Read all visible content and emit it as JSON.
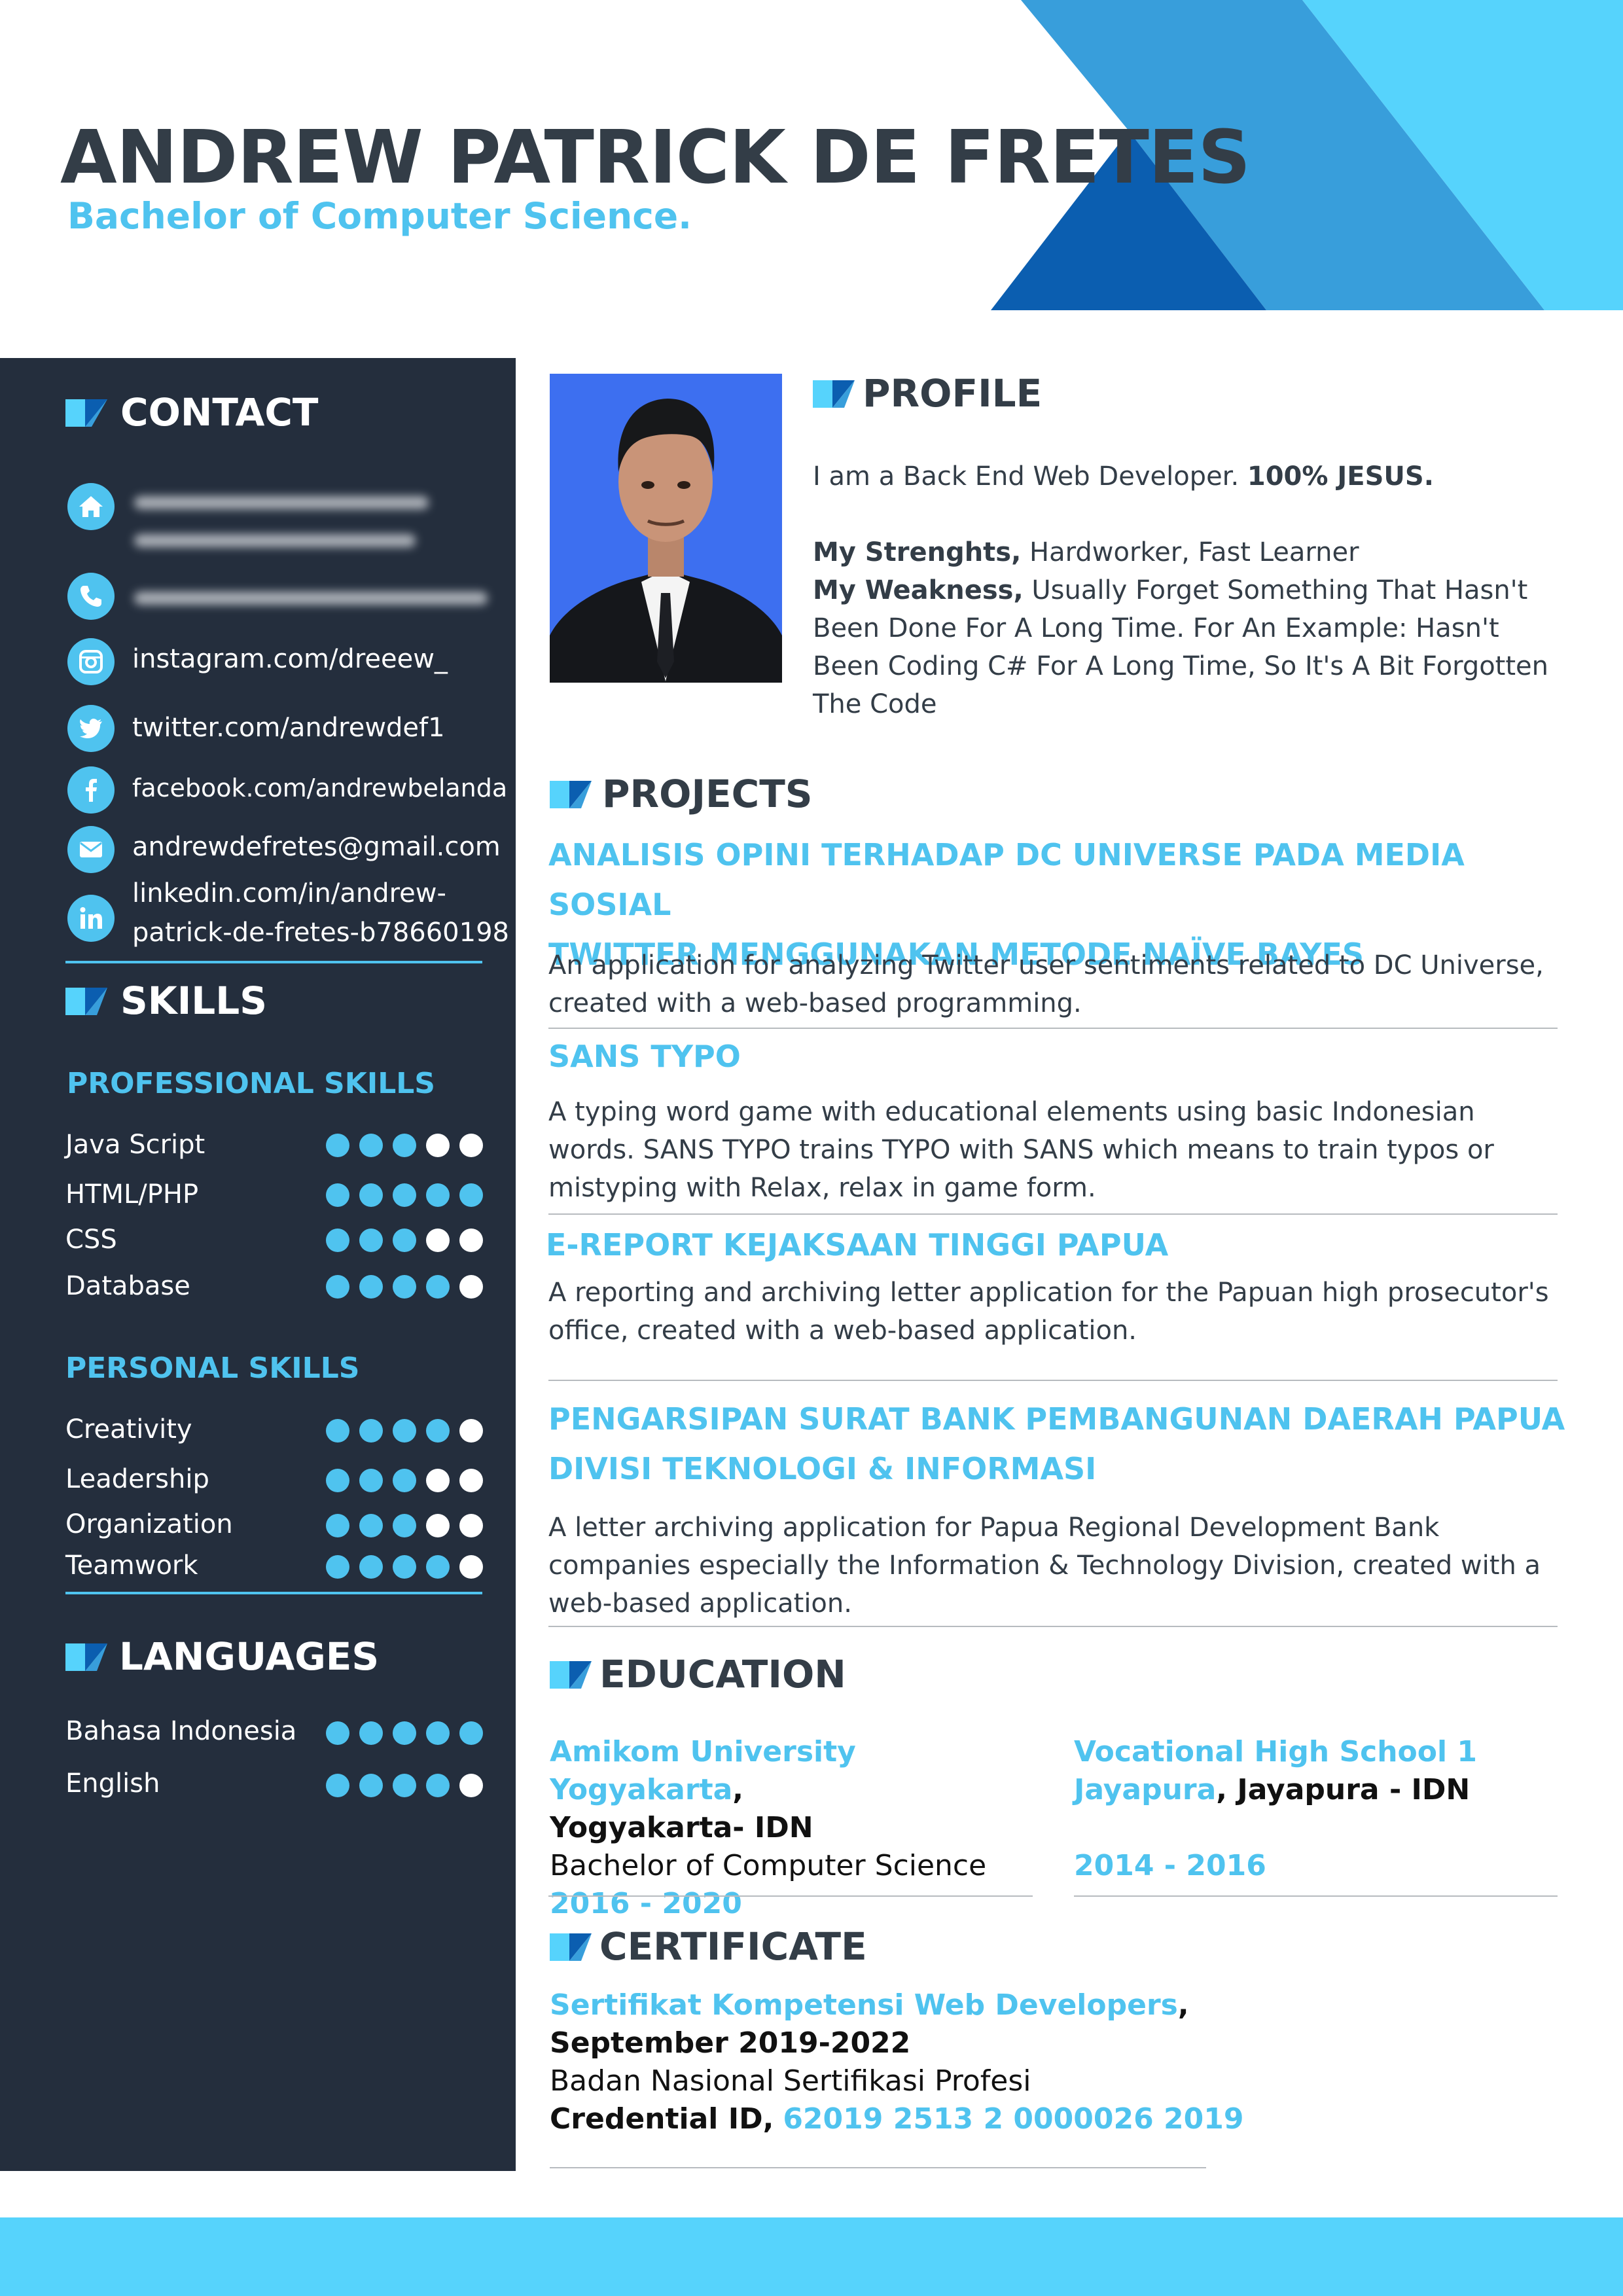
{
  "header": {
    "name": "ANDREW PATRICK DE FRETES",
    "degree": "Bachelor of Computer Science."
  },
  "colors": {
    "accent": "#4fc3ef",
    "sidebar": "#242e3d",
    "dark_text": "#333d47",
    "blue_dark": "#0b5eb0",
    "blue_mid": "#389edb",
    "blue_light": "#56d3fc"
  },
  "contact": {
    "title": "CONTACT",
    "items": [
      {
        "icon": "home-icon",
        "text": ""
      },
      {
        "icon": "phone-icon",
        "text": ""
      },
      {
        "icon": "instagram-icon",
        "text": "instagram.com/dreeew_"
      },
      {
        "icon": "twitter-icon",
        "text": "twitter.com/andrewdef1"
      },
      {
        "icon": "facebook-icon",
        "text": "facebook.com/andrewbelanda"
      },
      {
        "icon": "email-icon",
        "text": "andrewdefretes@gmail.com"
      },
      {
        "icon": "linkedin-icon",
        "text_line1": "linkedin.com/in/andrew-",
        "text_line2": "patrick-de-fretes-b78660198"
      }
    ]
  },
  "skills": {
    "title": "SKILLS",
    "professional_title": "PROFESSIONAL SKILLS",
    "professional": [
      {
        "name": "Java Script",
        "level": 3,
        "max": 5
      },
      {
        "name": "HTML/PHP",
        "level": 5,
        "max": 5
      },
      {
        "name": "CSS",
        "level": 3,
        "max": 5
      },
      {
        "name": "Database",
        "level": 4,
        "max": 5
      }
    ],
    "personal_title": "PERSONAL SKILLS",
    "personal": [
      {
        "name": "Creativity",
        "level": 4,
        "max": 5
      },
      {
        "name": "Leadership",
        "level": 3,
        "max": 5
      },
      {
        "name": "Organization",
        "level": 3,
        "max": 5
      },
      {
        "name": "Teamwork",
        "level": 4,
        "max": 5
      }
    ]
  },
  "languages": {
    "title": "LANGUAGES",
    "items": [
      {
        "name": "Bahasa Indonesia",
        "level": 5,
        "max": 5
      },
      {
        "name": "English",
        "level": 4,
        "max": 5
      }
    ]
  },
  "profile": {
    "title": "PROFILE",
    "intro": "I am a Back End Web Developer.",
    "intro_bold": "100% JESUS.",
    "strengths_label": "My Strenghts,",
    "strengths": "Hardworker, Fast Learner",
    "weakness_label": "My Weakness,",
    "weakness": "Usually Forget Something That Hasn't Been Done For A Long Time. For An Example: Hasn't Been Coding C# For A Long Time, So It's A Bit Forgotten The Code"
  },
  "projects": {
    "title": "PROJECTS",
    "items": [
      {
        "title_line1": "ANALISIS OPINI TERHADAP DC UNIVERSE PADA MEDIA SOSIAL",
        "title_line2": "TWITTER MENGGUNAKAN METODE NAÏVE BAYES",
        "desc": "An application for analyzing Twitter user sentiments related to DC Universe, created with a web-based programming."
      },
      {
        "title_line1": "SANS TYPO",
        "desc": "A typing word game with educational elements using basic Indonesian words. SANS TYPO trains TYPO with SANS which means to train typos or mistyping with Relax, relax in game form."
      },
      {
        "title_line1": "E-REPORT KEJAKSAAN TINGGI PAPUA",
        "desc": "A reporting and archiving letter application for the Papuan high prosecutor's office, created with a web-based application."
      },
      {
        "title_line1": "PENGARSIPAN SURAT BANK PEMBANGUNAN DAERAH PAPUA",
        "title_line2": "DIVISI TEKNOLOGI & INFORMASI",
        "desc": "A letter archiving application for Papua Regional Development Bank companies especially the Information & Technology Division, created with a web-based application."
      }
    ]
  },
  "education": {
    "title": "EDUCATION",
    "items": [
      {
        "school": "Amikom University Yogyakarta",
        "sep": ",",
        "location": "Yogyakarta- IDN",
        "degree": "Bachelor of Computer Science",
        "years": "2016 - 2020"
      },
      {
        "school_line1": "Vocational High School 1",
        "school_line2": "Jayapura",
        "location": ", Jayapura - IDN",
        "years": "2014 - 2016"
      }
    ]
  },
  "certificate": {
    "title": "CERTIFICATE",
    "name": "Sertifikat Kompetensi Web Developers",
    "sep": ",",
    "period": "September 2019-2022",
    "issuer": "Badan Nasional Sertifikasi Profesi",
    "credential_label": "Credential ID,",
    "credential_id": "62019 2513 2 0000026 2019"
  }
}
